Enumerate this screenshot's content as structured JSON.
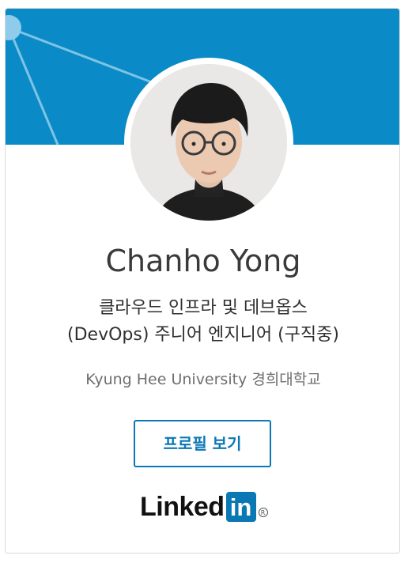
{
  "profile": {
    "name": "Chanho Yong",
    "headline_line1": "클라우드 인프라 및 데브옵스",
    "headline_line2": "(DevOps) 주니어 엔지니어 (구직중)",
    "school": "Kyung Hee University 경희대학교"
  },
  "actions": {
    "view_profile_label": "프로필 보기"
  },
  "brand": {
    "logo_text": "Linked",
    "logo_box_text": "in",
    "registered_mark": "R",
    "accent_color": "#0a78b5",
    "banner_color": "#0a8bc7"
  },
  "icons": {
    "avatar": "profile-photo"
  }
}
